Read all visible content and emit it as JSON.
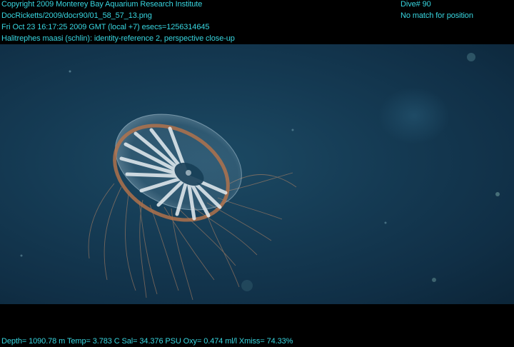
{
  "header": {
    "copyright": "Copyright 2009 Monterey Bay Aquarium Research Institute",
    "file_path": "DocRicketts/2009/docr90/01_58_57_13.png",
    "timestamp": "Fri Oct 23 16:17:25 2009 GMT (local +7)  esecs=1256314645",
    "annotation": "Halitrephes maasi (schlin): identity-reference 2, perspective close-up",
    "dive": "Dive# 90",
    "position": "No match for position"
  },
  "footer": {
    "telemetry": "Depth= 1090.78 m  Temp= 3.783 C  Sal= 34.376 PSU  Oxy= 0.474 ml/l  Xmiss= 74.33%"
  },
  "colors": {
    "overlay_text": "#38d6e0",
    "letterbox": "#000000",
    "water": "#153b54"
  }
}
